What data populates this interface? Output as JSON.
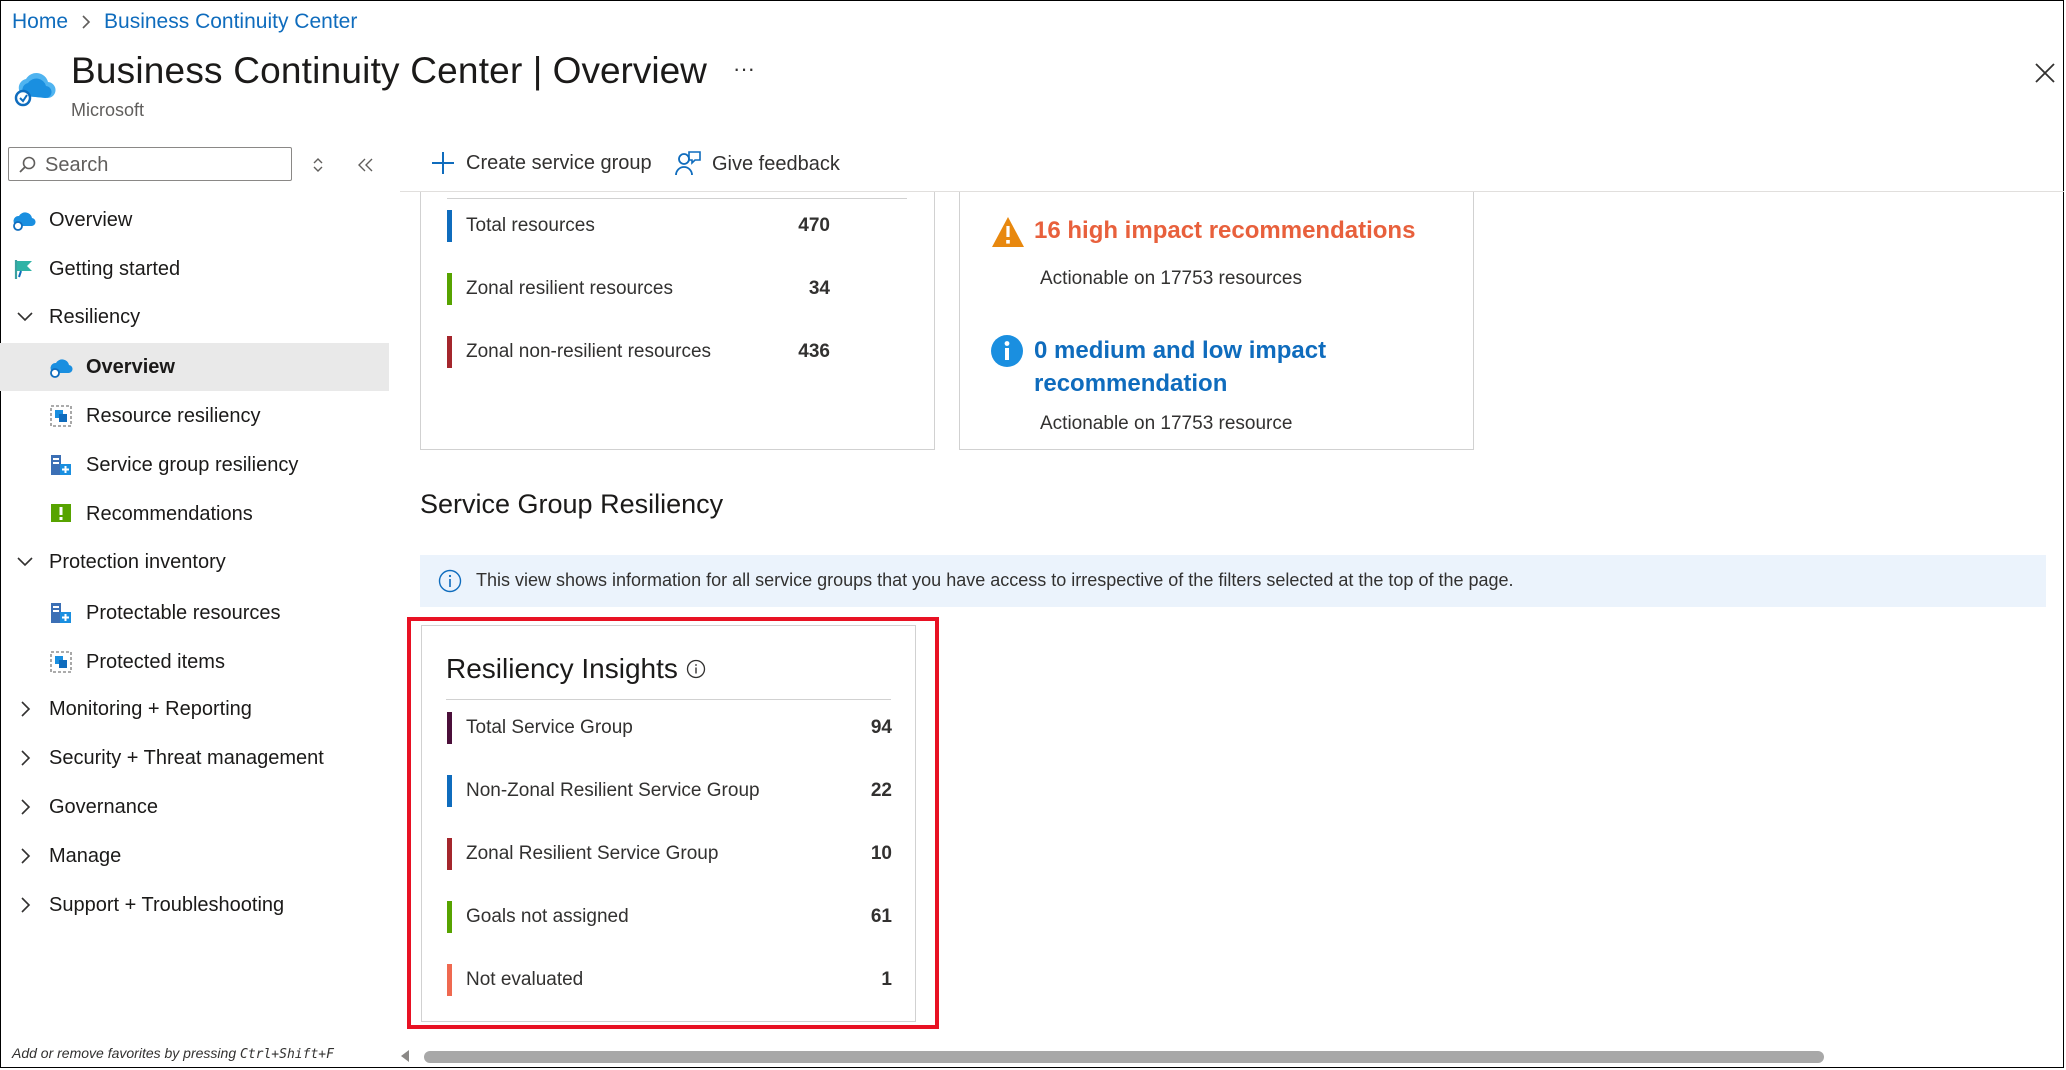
{
  "breadcrumb": {
    "home": "Home",
    "separator": ">",
    "current": "Business Continuity Center"
  },
  "header": {
    "title": "Business Continuity Center",
    "title_separator": "|",
    "page": "Overview",
    "more": "···",
    "subtitle": "Microsoft"
  },
  "sidebar": {
    "search_placeholder": "Search",
    "items": [
      {
        "label": "Overview",
        "icon": "cloud-overview-icon"
      },
      {
        "label": "Getting started",
        "icon": "flag-icon"
      },
      {
        "label": "Resiliency",
        "icon": "chevron-down-icon",
        "expanded": true
      },
      {
        "label": "Overview",
        "icon": "cloud-overview-icon",
        "selected": true
      },
      {
        "label": "Resource resiliency",
        "icon": "resource-icon"
      },
      {
        "label": "Service group resiliency",
        "icon": "service-group-icon"
      },
      {
        "label": "Recommendations",
        "icon": "exclamation-icon"
      },
      {
        "label": "Protection inventory",
        "icon": "chevron-down-icon",
        "expanded": true
      },
      {
        "label": "Protectable resources",
        "icon": "service-group-icon"
      },
      {
        "label": "Protected items",
        "icon": "resource-icon"
      },
      {
        "label": "Monitoring + Reporting",
        "icon": "chevron-right-icon"
      },
      {
        "label": "Security + Threat management",
        "icon": "chevron-right-icon"
      },
      {
        "label": "Governance",
        "icon": "chevron-right-icon"
      },
      {
        "label": "Manage",
        "icon": "chevron-right-icon"
      },
      {
        "label": "Support + Troubleshooting",
        "icon": "chevron-right-icon"
      }
    ],
    "footer": "Add or remove favorites by pressing",
    "footer_shortcut": "Ctrl+Shift+F"
  },
  "toolbar": {
    "create_label": "Create service group",
    "feedback_label": "Give feedback"
  },
  "resource_card": {
    "rows": [
      {
        "label": "Total resources",
        "value": "470",
        "color": "#0f6cbd"
      },
      {
        "label": "Zonal resilient resources",
        "value": "34",
        "color": "#57a300"
      },
      {
        "label": "Zonal non-resilient resources",
        "value": "436",
        "color": "#a4262c"
      }
    ]
  },
  "recommendation_card": {
    "high_title": "16 high impact recommendations",
    "high_sub": "Actionable on 17753 resources",
    "med_title_1": "0 medium and low impact",
    "med_title_2": "recommendation",
    "med_sub": "Actionable on 17753 resource",
    "colors": {
      "high": "#e8603c",
      "info": "#0f6cbd"
    }
  },
  "service_group": {
    "title": "Service Group Resiliency",
    "banner": "This view shows information for all service groups that you have access to irrespective of the filters selected at the top of the page."
  },
  "insights": {
    "title": "Resiliency Insights",
    "rows": [
      {
        "label": "Total Service Group",
        "value": "94",
        "color": "#4b0f3a"
      },
      {
        "label": "Non-Zonal Resilient Service Group",
        "value": "22",
        "color": "#0f6cbd"
      },
      {
        "label": "Zonal Resilient Service Group",
        "value": "10",
        "color": "#a4262c"
      },
      {
        "label": "Goals not assigned",
        "value": "61",
        "color": "#57a300"
      },
      {
        "label": "Not evaluated",
        "value": "1",
        "color": "#ef6950"
      }
    ],
    "highlight_color": "#e81123"
  }
}
